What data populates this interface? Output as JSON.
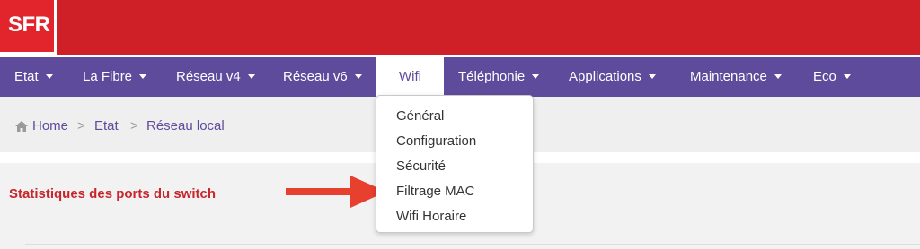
{
  "brand": {
    "logo_text": "SFR"
  },
  "colors": {
    "header_red": "#cf2027",
    "nav_purple": "#5f4b9c",
    "title_red": "#c8262d",
    "arrow_red": "#e8402f"
  },
  "nav": {
    "items": [
      {
        "label": "Etat",
        "has_caret": true
      },
      {
        "label": "La Fibre",
        "has_caret": true
      },
      {
        "label": "Réseau v4",
        "has_caret": true
      },
      {
        "label": "Réseau v6",
        "has_caret": true
      },
      {
        "label": "Wifi",
        "has_caret": false,
        "active": true
      },
      {
        "label": "Téléphonie",
        "has_caret": true
      },
      {
        "label": "Applications",
        "has_caret": true
      },
      {
        "label": "Maintenance",
        "has_caret": true
      },
      {
        "label": "Eco",
        "has_caret": true
      }
    ]
  },
  "dropdown": {
    "items": [
      "Général",
      "Configuration",
      "Sécurité",
      "Filtrage MAC",
      "Wifi Horaire"
    ]
  },
  "breadcrumb": {
    "icon": "home-icon",
    "items": [
      "Home",
      "Etat",
      "Réseau local"
    ],
    "separator": ">"
  },
  "section": {
    "title": "Statistiques des ports du switch"
  },
  "annotation": {
    "icon": "red-arrow-right-icon"
  }
}
